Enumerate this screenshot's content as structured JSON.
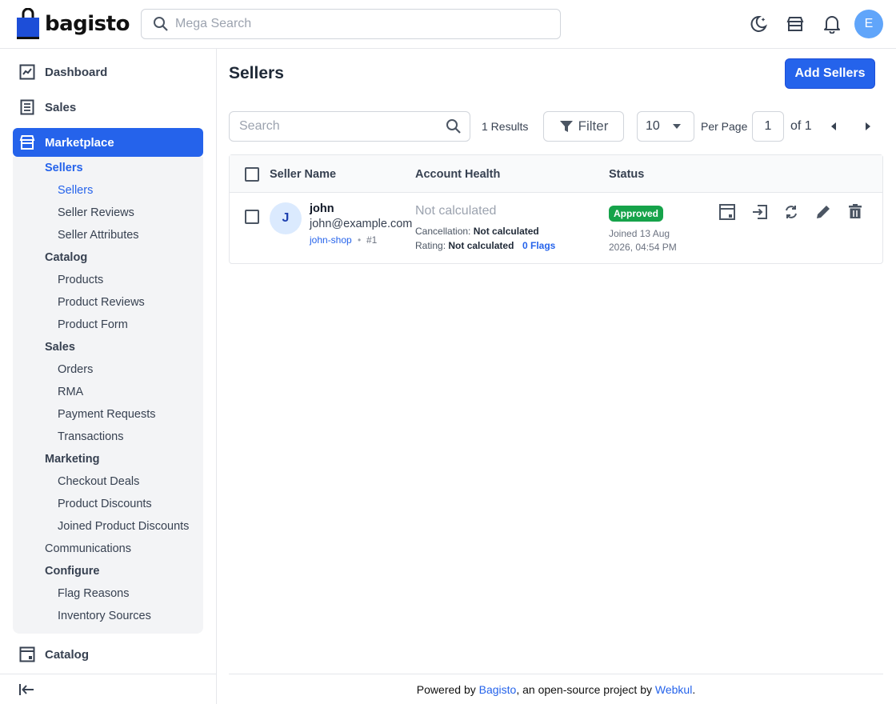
{
  "header": {
    "logo_text": "bagisto",
    "search_placeholder": "Mega Search",
    "avatar_initial": "E",
    "icons": [
      "dark-mode-icon",
      "storefront-icon",
      "notification-bell-icon"
    ]
  },
  "sidebar": {
    "top_items": [
      {
        "label": "Dashboard",
        "icon": "dashboard-icon"
      },
      {
        "label": "Sales",
        "icon": "sales-receipt-icon"
      },
      {
        "label": "Marketplace",
        "icon": "marketplace-store-icon",
        "active": true
      }
    ],
    "sub_items": [
      "Sellers",
      "Sellers",
      "Seller Reviews",
      "Seller Attributes",
      "Catalog",
      "Products",
      "Product Reviews",
      "Product Form",
      "Sales",
      "Orders",
      "RMA",
      "Payment Requests",
      "Transactions",
      "Marketing",
      "Checkout Deals",
      "Product Discounts",
      "Joined Product Discounts",
      "Communications",
      "Configure",
      "Flag Reasons",
      "Inventory Sources"
    ],
    "bottom_item": {
      "label": "Catalog",
      "icon": "catalog-icon"
    },
    "colors": {
      "active_bg": "#2563eb",
      "submenu_bg": "#f3f4f6"
    }
  },
  "main": {
    "title": "Sellers",
    "add_button": "Add Sellers",
    "search_placeholder": "Search",
    "results": "1 Results",
    "filter_label": "Filter",
    "per_page_value": "10",
    "per_page_label": "Per Page",
    "page_value": "1",
    "of_label": "of 1"
  },
  "table": {
    "columns": [
      "Seller Name",
      "Account Health",
      "Status"
    ],
    "rows": [
      {
        "avatar": "J",
        "name": "john",
        "email": "john@example.com",
        "shop": "john-shop",
        "separator": "•",
        "id": "#1",
        "health": "Not calculated",
        "cancellation_label": "Cancellation:",
        "cancellation_value": "Not calculated",
        "rating_label": "Rating:",
        "rating_value": "Not calculated",
        "flags": "0 Flags",
        "status": "Approved",
        "joined_line1": "Joined 13 Aug",
        "joined_line2": "2026, 04:54 PM",
        "actions": [
          "view-store-icon",
          "login-as-seller-icon",
          "sync-icon",
          "edit-icon",
          "delete-icon"
        ]
      }
    ]
  },
  "footer": {
    "prefix": "Powered by ",
    "link1": "Bagisto",
    "middle": ", an open-source project by ",
    "link2": "Webkul",
    "suffix": "."
  },
  "colors": {
    "accent": "#2563eb",
    "approved": "#16a34a"
  }
}
